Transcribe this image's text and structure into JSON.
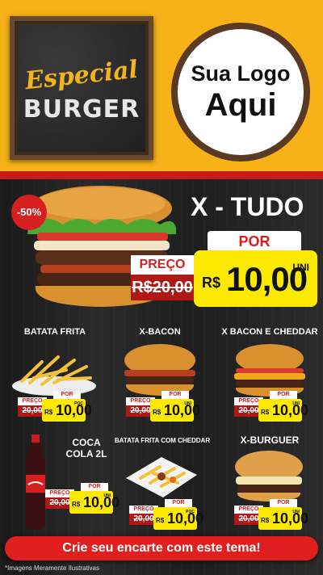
{
  "header": {
    "board_line1": "Especial",
    "board_line2": "BURGER",
    "logo_line1": "Sua Logo",
    "logo_line2": "Aqui"
  },
  "featured": {
    "badge": "-50%",
    "title": "X - TUDO",
    "preco_label": "PREÇO",
    "old_price": "R$20,00",
    "por_label": "POR",
    "currency": "R$",
    "new_price": "10,00",
    "unit": "UNI"
  },
  "products": [
    {
      "name": "BATATA FRITA",
      "preco": "PREÇO",
      "old": "20,00",
      "por": "POR",
      "rs": "R$",
      "price": "10,00",
      "unit": "POC"
    },
    {
      "name": "X-BACON",
      "preco": "PREÇO",
      "old": "20,00",
      "por": "POR",
      "rs": "R$",
      "price": "10,00",
      "unit": "UNI"
    },
    {
      "name": "X BACON E CHEDDAR",
      "preco": "PREÇO",
      "old": "20,00",
      "por": "POR",
      "rs": "R$",
      "price": "10,00",
      "unit": "UNI"
    },
    {
      "name": "COCA COLA 2L",
      "preco": "PREÇO",
      "old": "20,00",
      "por": "POR",
      "rs": "R$",
      "price": "10,00",
      "unit": "UNI"
    },
    {
      "name": "BATATA FRITA COM CHEDDAR",
      "preco": "PREÇO",
      "old": "20,00",
      "por": "POR",
      "rs": "R$",
      "price": "10,00",
      "unit": "POC"
    },
    {
      "name": "X-BURGUER",
      "preco": "PREÇO",
      "old": "20,00",
      "por": "POR",
      "rs": "R$",
      "price": "10,00",
      "unit": "UNI"
    }
  ],
  "cta": "Crie seu encarte com este tema!",
  "footnote": "*Imagens Meramente Ilustrativas",
  "colors": {
    "yellow": "#f7b218",
    "red": "#d61f1f",
    "price_yellow": "#fde900"
  }
}
